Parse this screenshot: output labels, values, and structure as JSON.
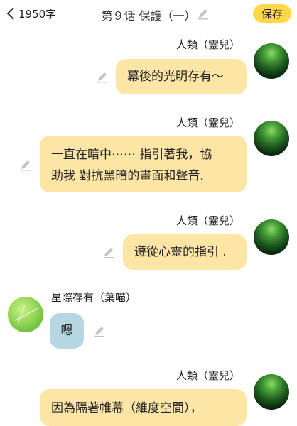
{
  "header": {
    "back_label": "1950字",
    "title": "第９话 保護（一）",
    "save_label": "保存"
  },
  "messages": [
    {
      "name": "人類（靈兒）",
      "lines": [
        "幕後的光明存有～"
      ]
    },
    {
      "name": "人類（靈兒）",
      "lines": [
        "一直在暗中⋯⋯ 指引著我，協",
        "助我 對抗黑暗的畫面和聲音."
      ]
    },
    {
      "name": "人類（靈兒）",
      "lines": [
        "遵從心靈的指引 ."
      ]
    },
    {
      "name": "星際存有（葉喵）",
      "lines": [
        "嗯"
      ]
    },
    {
      "name": "人類（靈兒）",
      "lines": [
        "因為隔著帷幕（維度空間），"
      ]
    }
  ],
  "colors": {
    "save_button": "#ffd84a",
    "bubble_right": "#fde5a6",
    "bubble_left": "#b6d6e2"
  },
  "icons": {
    "back": "chevron-left-icon",
    "edit": "pencil-icon"
  }
}
